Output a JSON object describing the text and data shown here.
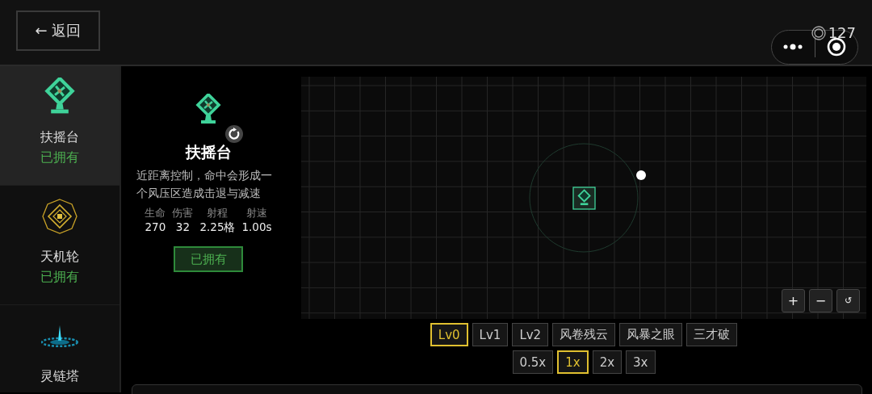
{
  "back_button": {
    "label": "← 返回"
  },
  "counter": {
    "value": "127"
  },
  "sidebar": {
    "items": [
      {
        "kind": "fan",
        "name": "扶摇台",
        "status": "已拥有",
        "selected": true
      },
      {
        "kind": "wheel",
        "name": "天机轮",
        "status": "已拥有",
        "selected": false
      },
      {
        "kind": "spire",
        "name": "灵链塔",
        "selected": false
      }
    ]
  },
  "detail": {
    "kind": "fan",
    "title": "扶摇台",
    "description": "近距离控制，命中会形成一个风压区造成击退与减速",
    "stats": [
      {
        "label": "生命",
        "value": "270"
      },
      {
        "label": "伤害",
        "value": "32"
      },
      {
        "label": "射程",
        "value": "2.25格"
      },
      {
        "label": "射速",
        "value": "1.00s"
      }
    ],
    "button": "已拥有"
  },
  "preview": {
    "zoom_controls": [
      "+",
      "−",
      "↺"
    ],
    "levels": [
      {
        "label": "Lv0",
        "selected": true
      },
      {
        "label": "Lv1",
        "selected": false
      },
      {
        "label": "Lv2",
        "selected": false
      },
      {
        "label": "风卷残云",
        "selected": false
      },
      {
        "label": "风暴之眼",
        "selected": false
      },
      {
        "label": "三才破",
        "selected": false
      }
    ],
    "speeds": [
      {
        "label": "0.5x",
        "selected": false
      },
      {
        "label": "1x",
        "selected": true
      },
      {
        "label": "2x",
        "selected": false
      },
      {
        "label": "3x",
        "selected": false
      }
    ]
  }
}
